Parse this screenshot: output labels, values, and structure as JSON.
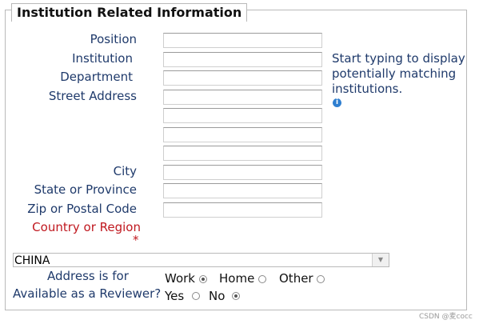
{
  "section": {
    "legend": "Institution Related Information"
  },
  "fields": {
    "position": {
      "label": "Position",
      "value": ""
    },
    "institution": {
      "label": "Institution",
      "value": ""
    },
    "department": {
      "label": "Department",
      "value": ""
    },
    "street_address": {
      "label": "Street Address",
      "lines": [
        "",
        "",
        "",
        ""
      ]
    },
    "city": {
      "label": "City",
      "value": ""
    },
    "state": {
      "label": "State or Province",
      "value": ""
    },
    "zip": {
      "label": "Zip or Postal Code",
      "value": ""
    },
    "country": {
      "label": "Country or Region",
      "required_marker": "*",
      "selected": "CHINA"
    }
  },
  "institution_hint": {
    "text": "Start typing to display potentially matching institutions.",
    "icon": "info-icon"
  },
  "address_for": {
    "label": "Address is for",
    "options": [
      "Work",
      "Home",
      "Other"
    ],
    "selected": "Work"
  },
  "reviewer": {
    "label": "Available as a Reviewer?",
    "options": [
      "Yes",
      "No"
    ],
    "selected": "No"
  },
  "watermark": "CSDN @麦cocc",
  "colors": {
    "label": "#1f3a6b",
    "required": "#c0181f",
    "info": "#2f7fd0"
  }
}
